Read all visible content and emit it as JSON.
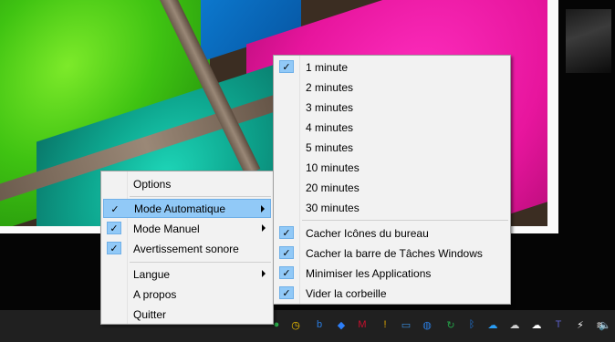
{
  "main_menu": {
    "items": [
      {
        "label": "Options",
        "checked": false,
        "submenu": false,
        "highlighted": false
      },
      {
        "label": "Mode Automatique",
        "checked": true,
        "submenu": true,
        "highlighted": true
      },
      {
        "label": "Mode Manuel",
        "checked": true,
        "submenu": true,
        "highlighted": false
      },
      {
        "label": "Avertissement sonore",
        "checked": true,
        "submenu": false,
        "highlighted": false
      },
      {
        "label": "Langue",
        "checked": false,
        "submenu": true,
        "highlighted": false
      },
      {
        "label": "A propos",
        "checked": false,
        "submenu": false,
        "highlighted": false
      },
      {
        "label": "Quitter",
        "checked": false,
        "submenu": false,
        "highlighted": false
      }
    ]
  },
  "sub_menu": {
    "intervals": [
      {
        "label": "1 minute",
        "checked": true
      },
      {
        "label": "2 minutes",
        "checked": false
      },
      {
        "label": "3 minutes",
        "checked": false
      },
      {
        "label": "4 minutes",
        "checked": false
      },
      {
        "label": "5 minutes",
        "checked": false
      },
      {
        "label": "10 minutes",
        "checked": false
      },
      {
        "label": "20 minutes",
        "checked": false
      },
      {
        "label": "30 minutes",
        "checked": false
      }
    ],
    "actions": [
      {
        "label": "Cacher Icônes du bureau",
        "checked": true
      },
      {
        "label": "Cacher la barre de Tâches Windows",
        "checked": true
      },
      {
        "label": "Minimiser les Applications",
        "checked": true
      },
      {
        "label": "Vider la corbeille",
        "checked": true
      }
    ]
  },
  "check_glyph": "✓",
  "taskbar": {
    "tray_icons": [
      {
        "name": "green-app-icon",
        "glyph": "●",
        "color": "#2bb24c"
      },
      {
        "name": "clock-app-icon",
        "glyph": "◷",
        "color": "#f2c200"
      },
      {
        "name": "bing-icon",
        "glyph": "b",
        "color": "#2a7de1"
      },
      {
        "name": "dropbox-icon",
        "glyph": "◆",
        "color": "#2d7ff9"
      },
      {
        "name": "mcafee-icon",
        "glyph": "M",
        "color": "#c8102e"
      },
      {
        "name": "security-warning-icon",
        "glyph": "!",
        "color": "#e0a800"
      },
      {
        "name": "display-icon",
        "glyph": "▭",
        "color": "#3a8fe0"
      },
      {
        "name": "network-globe-icon",
        "glyph": "◍",
        "color": "#2a7de1"
      },
      {
        "name": "sync-icon",
        "glyph": "↻",
        "color": "#24a148"
      },
      {
        "name": "bluetooth-icon",
        "glyph": "ᛒ",
        "color": "#1e7ae6"
      },
      {
        "name": "onedrive-icon",
        "glyph": "☁",
        "color": "#2a9df4"
      },
      {
        "name": "onedrive-personal-icon",
        "glyph": "☁",
        "color": "#d0d0d0"
      },
      {
        "name": "cloud-icon",
        "glyph": "☁",
        "color": "#ffffff"
      },
      {
        "name": "teams-icon",
        "glyph": "T",
        "color": "#5b5fc7"
      },
      {
        "name": "power-icon",
        "glyph": "⚡",
        "color": "#ffffff"
      },
      {
        "name": "wifi-icon",
        "glyph": "≋",
        "color": "#ffffff"
      },
      {
        "name": "volume-icon",
        "glyph": "🔈",
        "color": "#ffffff"
      }
    ]
  }
}
